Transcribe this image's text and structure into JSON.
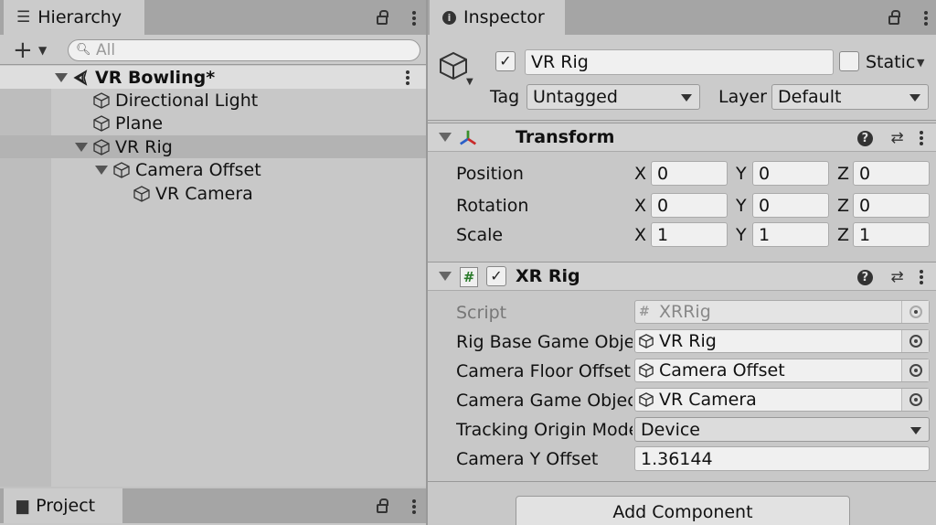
{
  "hierarchy": {
    "tab_label": "Hierarchy",
    "search_placeholder": "All",
    "items": [
      {
        "label": "VR Bowling*"
      },
      {
        "label": "Directional Light"
      },
      {
        "label": "Plane"
      },
      {
        "label": "VR Rig"
      },
      {
        "label": "Camera Offset"
      },
      {
        "label": "VR Camera"
      }
    ]
  },
  "project": {
    "tab_label": "Project"
  },
  "inspector": {
    "tab_label": "Inspector",
    "object_name": "VR Rig",
    "static_label": "Static",
    "tag_label": "Tag",
    "tag_value": "Untagged",
    "layer_label": "Layer",
    "layer_value": "Default",
    "transform": {
      "title": "Transform",
      "axes": [
        "X",
        "Y",
        "Z"
      ],
      "rows": [
        {
          "label": "Position",
          "x": "0",
          "y": "0",
          "z": "0"
        },
        {
          "label": "Rotation",
          "x": "0",
          "y": "0",
          "z": "0"
        },
        {
          "label": "Scale",
          "x": "1",
          "y": "1",
          "z": "1"
        }
      ]
    },
    "xr_rig": {
      "title": "XR Rig",
      "script_label": "Script",
      "script_value": "XRRig",
      "rig_base_label": "Rig Base Game Objec",
      "rig_base_value": "VR Rig",
      "floor_offset_label": "Camera Floor Offset (",
      "floor_offset_value": "Camera Offset",
      "camera_go_label": "Camera Game Object",
      "camera_go_value": "VR Camera",
      "tracking_label": "Tracking Origin Mode",
      "tracking_value": "Device",
      "cam_y_label": "Camera Y Offset",
      "cam_y_value": "1.36144"
    },
    "add_component_label": "Add Component"
  }
}
